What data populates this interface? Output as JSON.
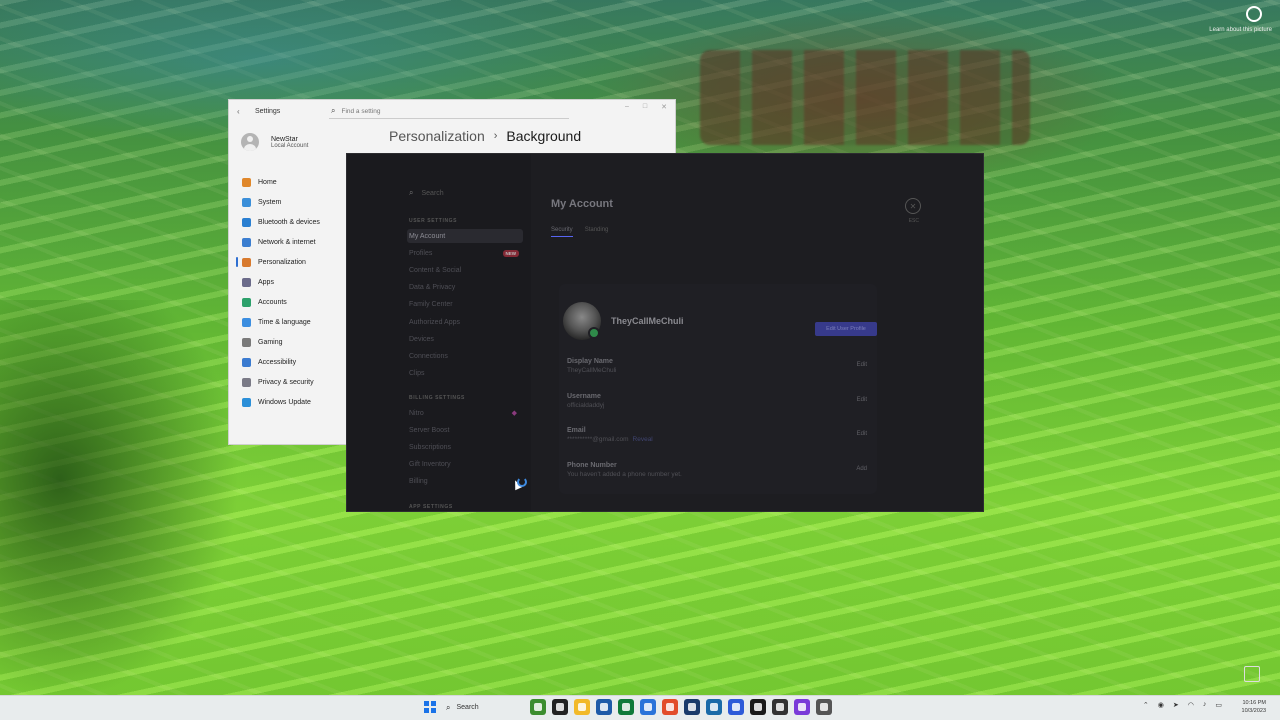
{
  "desktop": {
    "corner_text": "Learn about this picture"
  },
  "settings": {
    "window_title": "Settings",
    "search_placeholder": "Find a setting",
    "user": {
      "name": "NewStar",
      "account_type": "Local Account"
    },
    "breadcrumb": {
      "parent": "Personalization",
      "current": "Background"
    },
    "nav": [
      {
        "label": "Home",
        "color": "#e0872a"
      },
      {
        "label": "System",
        "color": "#3b8fd9"
      },
      {
        "label": "Bluetooth & devices",
        "color": "#2a7fd1"
      },
      {
        "label": "Network & internet",
        "color": "#3b7ed0"
      },
      {
        "label": "Personalization",
        "color": "#d87a2e"
      },
      {
        "label": "Apps",
        "color": "#6b6b8a"
      },
      {
        "label": "Accounts",
        "color": "#2ca06b"
      },
      {
        "label": "Time & language",
        "color": "#3c8ee0"
      },
      {
        "label": "Gaming",
        "color": "#7a7a7a"
      },
      {
        "label": "Accessibility",
        "color": "#3b7bd0"
      },
      {
        "label": "Privacy & security",
        "color": "#7a7a86"
      },
      {
        "label": "Windows Update",
        "color": "#2b8fd8"
      }
    ],
    "active_nav": "Personalization"
  },
  "discord": {
    "search_placeholder": "Search",
    "sections": {
      "user": "USER SETTINGS",
      "billing": "BILLING SETTINGS",
      "app": "APP SETTINGS"
    },
    "user_items": [
      "My Account",
      "Profiles",
      "Content & Social",
      "Data & Privacy",
      "Family Center",
      "Authorized Apps",
      "Devices",
      "Connections",
      "Clips"
    ],
    "profiles_badge": "NEW",
    "billing_items": [
      "Nitro",
      "Server Boost",
      "Subscriptions",
      "Gift Inventory",
      "Billing"
    ],
    "heading": "My Account",
    "tabs": [
      "Security",
      "Standing"
    ],
    "close_label": "ESC",
    "profile_name": "TheyCallMeChuli",
    "edit_profile_label": "Edit User Profile",
    "fields": [
      {
        "label": "Display Name",
        "value": "TheyCallMeChuli",
        "action": "Edit"
      },
      {
        "label": "Username",
        "value": "officialdaddyj",
        "action": "Edit"
      },
      {
        "label": "Email",
        "value": "**********@gmail.com",
        "reveal": "Reveal",
        "action": "Edit"
      },
      {
        "label": "Phone Number",
        "value": "You haven't added a phone number yet.",
        "action": "Add"
      }
    ],
    "accent": "#5865f2"
  },
  "taskbar": {
    "search_label": "Search",
    "app_colors": [
      "#3c8d2f",
      "#222222",
      "#f2b928",
      "#1e5aa8",
      "#0f7a3a",
      "#2a73d9",
      "#e24d2b",
      "#1a3a6a",
      "#1a6aa8",
      "#2e5ad8",
      "#1a1a1a",
      "#333333",
      "#7a3ad8",
      "#555555"
    ],
    "time": "10:16 PM",
    "date": "10/3/2023"
  }
}
